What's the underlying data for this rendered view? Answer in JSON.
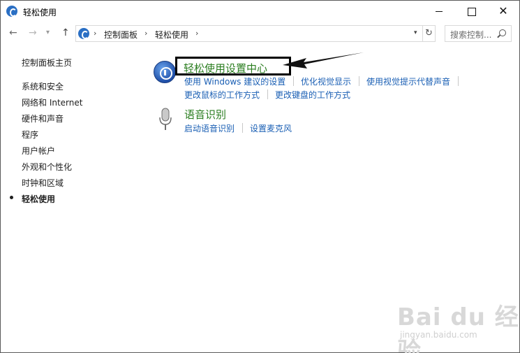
{
  "window": {
    "title": "轻松使用",
    "close_glyph": "✕"
  },
  "nav": {
    "back_glyph": "←",
    "forward_glyph": "→",
    "dropdown_glyph": "▾",
    "up_glyph": "↑",
    "refresh_glyph": "↻"
  },
  "breadcrumb": {
    "sep": "›",
    "items": [
      "控制面板",
      "轻松使用"
    ],
    "dropdown_glyph": "▾"
  },
  "search": {
    "placeholder": "搜索控制..."
  },
  "sidebar": {
    "home": "控制面板主页",
    "items": [
      {
        "label": "系统和安全"
      },
      {
        "label": "网络和 Internet"
      },
      {
        "label": "硬件和声音"
      },
      {
        "label": "程序"
      },
      {
        "label": "用户帐户"
      },
      {
        "label": "外观和个性化"
      },
      {
        "label": "时钟和区域"
      },
      {
        "label": "轻松使用"
      }
    ]
  },
  "categories": [
    {
      "title": "轻松使用设置中心",
      "icon": "ease-of-access-icon",
      "links": [
        "使用 Windows 建议的设置",
        "优化视觉显示",
        "使用视觉提示代替声音",
        "更改鼠标的工作方式",
        "更改键盘的工作方式"
      ]
    },
    {
      "title": "语音识别",
      "icon": "microphone-icon",
      "links": [
        "启动语音识别",
        "设置麦克风"
      ]
    }
  ],
  "watermark": {
    "text": "Bai du 经验",
    "sub": "jingyan.baidu.com"
  },
  "colors": {
    "link": "#1a5fb4",
    "category_title": "#2a7d1f",
    "accent": "#2a6fc4"
  }
}
